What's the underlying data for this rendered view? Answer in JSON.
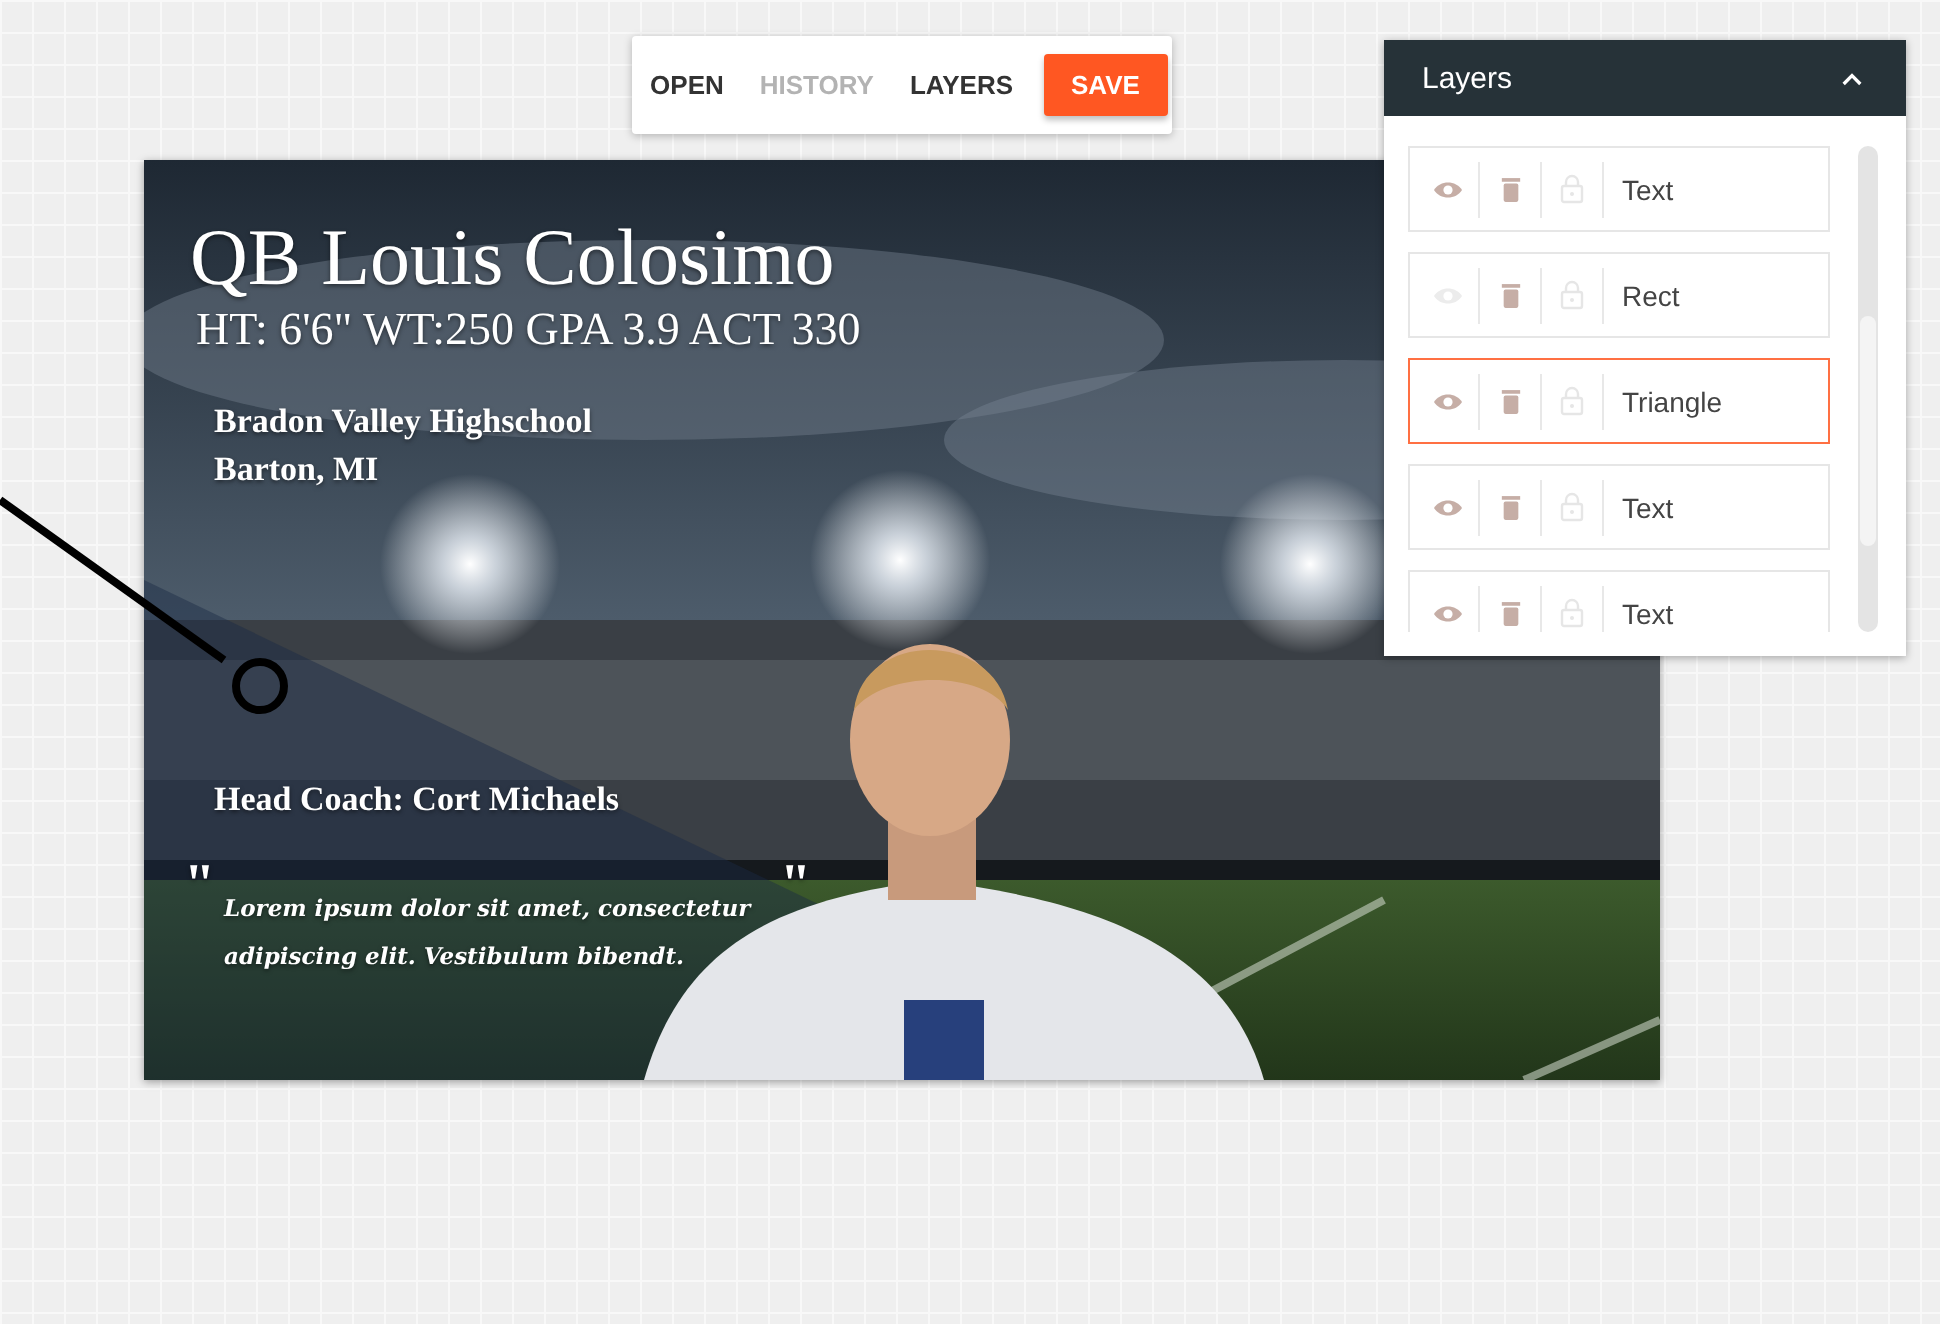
{
  "toolbar": {
    "buttons": [
      {
        "label": "OPEN",
        "kind": "text",
        "disabled": false
      },
      {
        "label": "HISTORY",
        "kind": "text",
        "disabled": true
      },
      {
        "label": "LAYERS",
        "kind": "text",
        "disabled": false
      },
      {
        "label": "SAVE",
        "kind": "primary",
        "disabled": false
      }
    ]
  },
  "canvas": {
    "texts": [
      {
        "kind": "title",
        "text": "QB Louis Colosimo"
      },
      {
        "kind": "stats",
        "text": "HT: 6'6\" WT:250 GPA 3.9 ACT 330"
      },
      {
        "kind": "school",
        "text": "Bradon Valley Highschool"
      },
      {
        "kind": "location",
        "text": "Barton, MI"
      },
      {
        "kind": "coach",
        "text": "Head Coach: Cort Michaels"
      },
      {
        "kind": "open_quote",
        "text": "\""
      },
      {
        "kind": "quote",
        "text": "Lorem ipsum dolor sit amet, consectetur adipiscing elit. Vestibulum bibendt."
      },
      {
        "kind": "close_quote",
        "text": "\""
      }
    ]
  },
  "layers_panel": {
    "title": "Layers",
    "expanded": true,
    "layers": [
      {
        "name": "Text",
        "visible": true,
        "selected": false
      },
      {
        "name": "Rect",
        "visible": false,
        "selected": false
      },
      {
        "name": "Triangle",
        "visible": true,
        "selected": true
      },
      {
        "name": "Text",
        "visible": true,
        "selected": false
      },
      {
        "name": "Text",
        "visible": true,
        "selected": false
      }
    ]
  }
}
